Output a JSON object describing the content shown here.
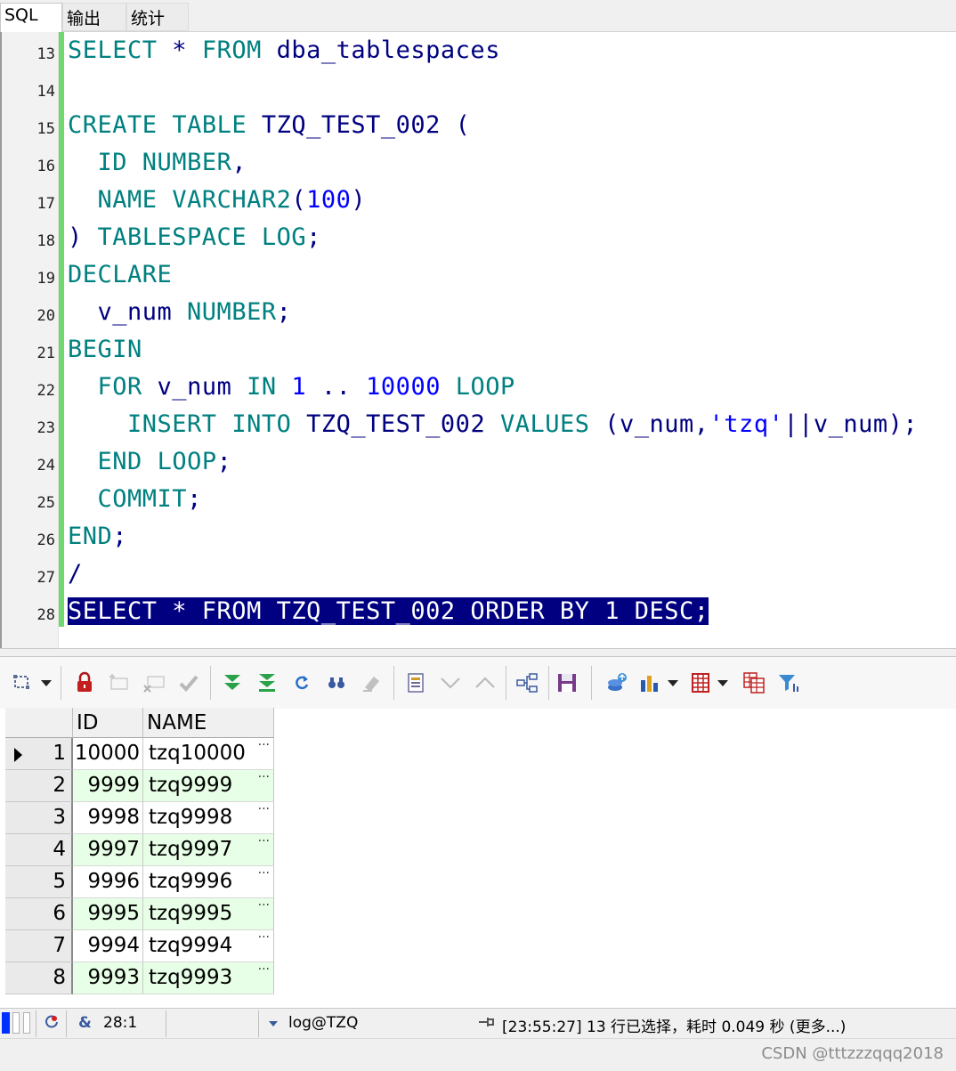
{
  "tabs": [
    {
      "label": "SQL",
      "active": true
    },
    {
      "label": "输出",
      "active": false
    },
    {
      "label": "统计",
      "active": false
    }
  ],
  "editor": {
    "line_numbers": [
      "13",
      "14",
      "15",
      "16",
      "17",
      "18",
      "19",
      "20",
      "21",
      "22",
      "23",
      "24",
      "25",
      "26",
      "27",
      "28"
    ],
    "lines": [
      [
        "SELECT",
        " * ",
        "FROM",
        " dba_tablespaces"
      ],
      [],
      [
        "CREATE",
        " ",
        "TABLE",
        " TZQ_TEST_002 ("
      ],
      [
        "  ",
        "ID",
        " ",
        "NUMBER",
        ","
      ],
      [
        "  ",
        "NAME",
        " ",
        "VARCHAR2",
        "(",
        "100",
        ")"
      ],
      [
        ") ",
        "TABLESPACE",
        " ",
        "LOG",
        ";"
      ],
      [
        "DECLARE"
      ],
      [
        "  v_num ",
        "NUMBER",
        ";"
      ],
      [
        "BEGIN"
      ],
      [
        "  ",
        "FOR",
        " v_num ",
        "IN",
        " ",
        "1",
        " .. ",
        "10000",
        " ",
        "LOOP"
      ],
      [
        "    ",
        "INSERT",
        " ",
        "INTO",
        " TZQ_TEST_002 ",
        "VALUES",
        " (v_num,",
        "'tzq'",
        "||v_num);"
      ],
      [
        "  ",
        "END",
        " ",
        "LOOP",
        ";"
      ],
      [
        "  ",
        "COMMIT",
        ";"
      ],
      [
        "END",
        ";"
      ],
      [
        "/"
      ],
      [
        "SELECT * FROM TZQ_TEST_002 ORDER BY 1 DESC;"
      ]
    ],
    "change_bar_color": "#6fd96f",
    "selection_color": "#000080"
  },
  "toolbar": {
    "icons": [
      "query-builder-icon",
      "lock-icon",
      "insert-record-icon",
      "delete-record-icon",
      "post-changes-icon",
      "next-page-icon",
      "last-page-icon",
      "refresh-icon",
      "find-icon",
      "clear-icon",
      "single-record-view-icon",
      "next-record-icon",
      "previous-record-icon",
      "tree-icon",
      "save-icon",
      "export-icon",
      "chart-icon",
      "grid-options-icon",
      "copy-grid-icon",
      "filter-icon"
    ]
  },
  "grid": {
    "columns": [
      "ID",
      "NAME"
    ],
    "rows": [
      {
        "n": "1",
        "id": "10000",
        "name": "tzq10000"
      },
      {
        "n": "2",
        "id": "9999",
        "name": "tzq9999"
      },
      {
        "n": "3",
        "id": "9998",
        "name": "tzq9998"
      },
      {
        "n": "4",
        "id": "9997",
        "name": "tzq9997"
      },
      {
        "n": "5",
        "id": "9996",
        "name": "tzq9996"
      },
      {
        "n": "6",
        "id": "9995",
        "name": "tzq9995"
      },
      {
        "n": "7",
        "id": "9994",
        "name": "tzq9994"
      },
      {
        "n": "8",
        "id": "9993",
        "name": "tzq9993"
      }
    ],
    "alt_row_color": "#e6ffe6",
    "dots": "···"
  },
  "status": {
    "amp": "&",
    "position": "28:1",
    "connection": "log@TZQ",
    "message": "[23:55:27]  13 行已选择，耗时 0.049 秒  (更多...)"
  },
  "watermark": "CSDN @tttzzzqqq2018"
}
